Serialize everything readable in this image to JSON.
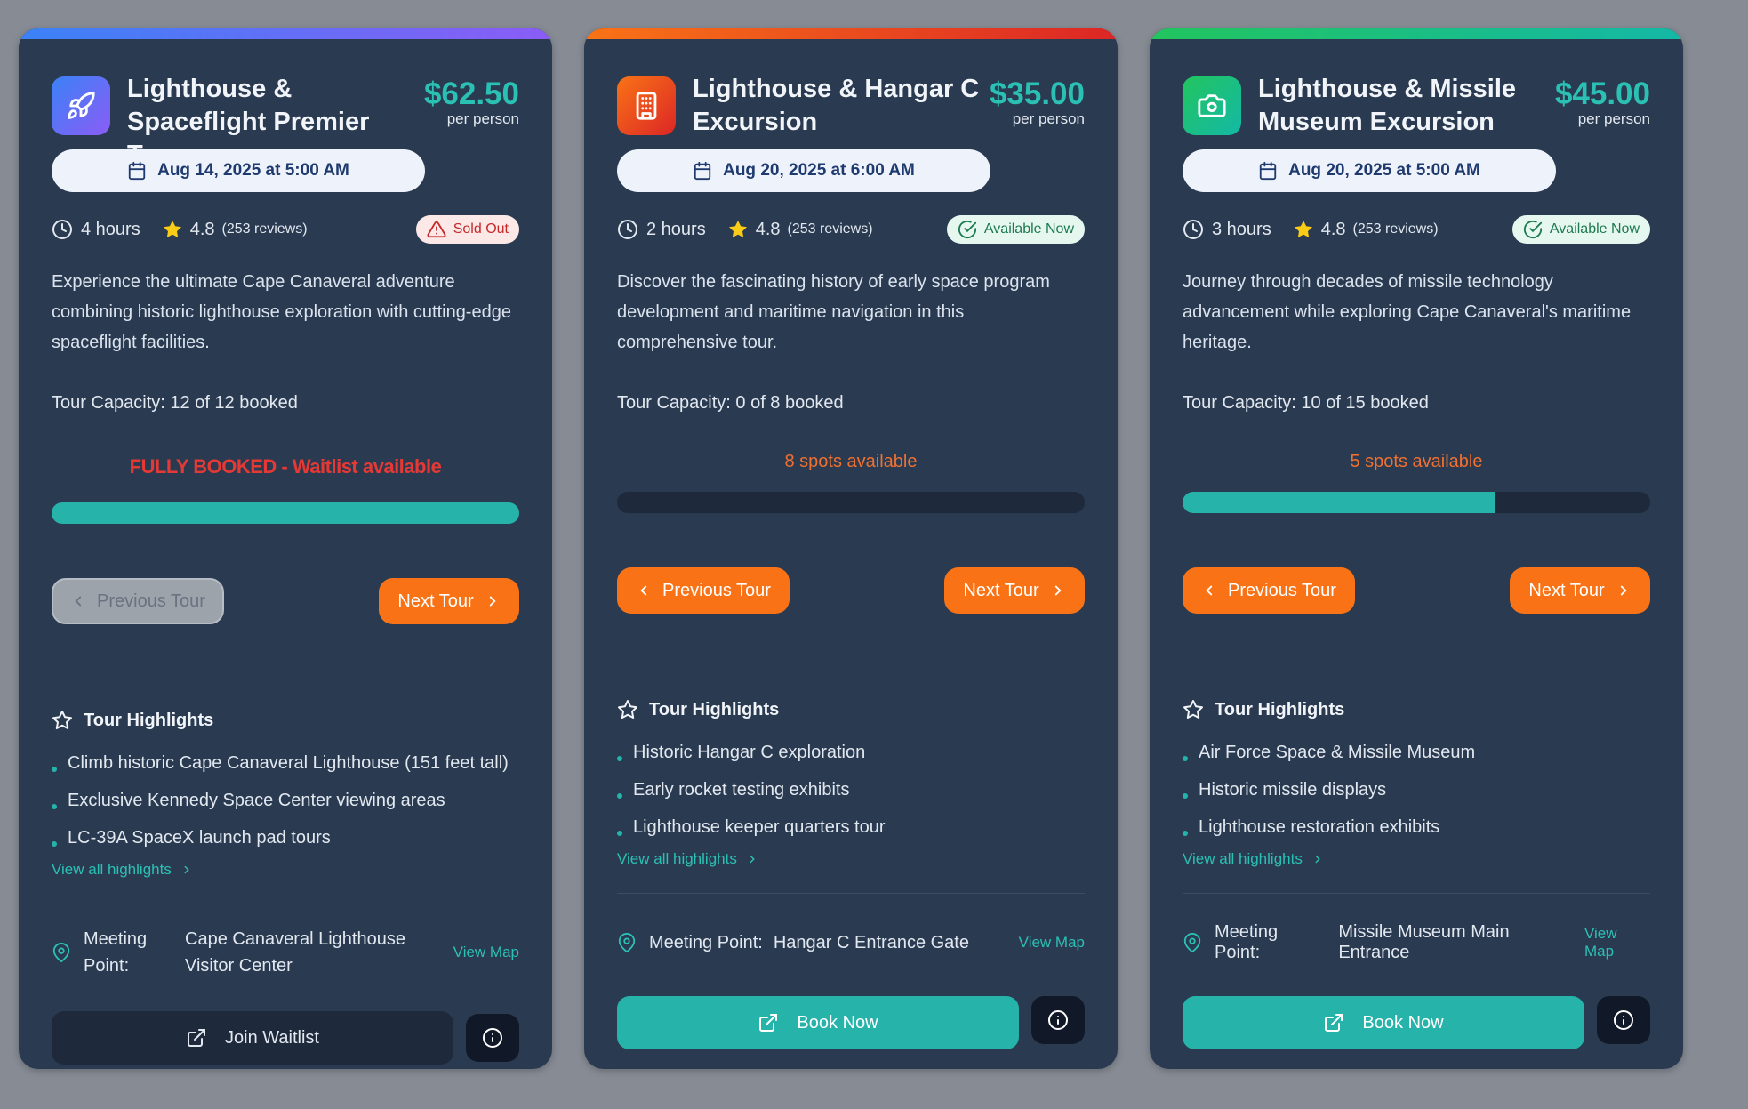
{
  "colors": {
    "teal_accent": "#2bc0b4",
    "orange_accent": "#f97316",
    "card_bg": "#2a3a50",
    "page_bg": "#868b94"
  },
  "cards": [
    {
      "icon": "rocket-icon",
      "icon_gradient": [
        "#3b82f6",
        "#8b5cf6"
      ],
      "top_gradient": [
        "#3b82f6",
        "#8b5cf6"
      ],
      "title": "Lighthouse & Spaceflight Premier Tour",
      "price": "$62.50",
      "per": "per person",
      "date": "Aug 14, 2025 at 5:00 AM",
      "duration": "4 hours",
      "rating": "4.8",
      "reviews": "(253 reviews)",
      "badge": "Sold Out",
      "badge_type": "sold",
      "description": "Experience the ultimate Cape Canaveral adventure combining historic lighthouse exploration with cutting-edge spaceflight facilities.",
      "capacity": "Tour Capacity: 12 of 12 booked",
      "availability": "FULLY BOOKED - Waitlist available",
      "availability_full": true,
      "progress_fraction": 1.0,
      "prev_label": "Previous Tour",
      "prev_disabled": true,
      "next_label": "Next Tour",
      "highlights_title": "Tour Highlights",
      "highlights": [
        "Climb historic Cape Canaveral Lighthouse (151 feet tall)",
        "Exclusive Kennedy Space Center viewing areas",
        "LC-39A SpaceX launch pad tours"
      ],
      "view_all": "View all highlights",
      "meeting_label": "Meeting Point:",
      "meeting_value": "Cape Canaveral Lighthouse Visitor Center",
      "view_map": "View Map",
      "cta_label": "Join Waitlist",
      "cta_type": "waitlist"
    },
    {
      "icon": "building-icon",
      "icon_gradient": [
        "#f97316",
        "#dc2626"
      ],
      "top_gradient": [
        "#f97316",
        "#dc2626"
      ],
      "title": "Lighthouse & Hangar C Excursion",
      "price": "$35.00",
      "per": "per person",
      "date": "Aug 20, 2025 at 6:00 AM",
      "duration": "2 hours",
      "rating": "4.8",
      "reviews": "(253 reviews)",
      "badge": "Available Now",
      "badge_type": "avail",
      "description": "Discover the fascinating history of early space program development and maritime navigation in this comprehensive tour.",
      "capacity": "Tour Capacity: 0 of 8 booked",
      "availability": "8 spots available",
      "availability_full": false,
      "progress_fraction": 0.0,
      "prev_label": "Previous Tour",
      "prev_disabled": false,
      "next_label": "Next Tour",
      "highlights_title": "Tour Highlights",
      "highlights": [
        "Historic Hangar C exploration",
        "Early rocket testing exhibits",
        "Lighthouse keeper quarters tour"
      ],
      "view_all": "View all highlights",
      "meeting_label": "Meeting Point:",
      "meeting_value": "Hangar C Entrance Gate",
      "view_map": "View Map",
      "cta_label": "Book Now",
      "cta_type": "book"
    },
    {
      "icon": "camera-icon",
      "icon_gradient": [
        "#22c55e",
        "#14b8a6"
      ],
      "top_gradient": [
        "#22c55e",
        "#14b8a6"
      ],
      "title": "Lighthouse & Missile Museum Excursion",
      "price": "$45.00",
      "per": "per person",
      "date": "Aug 20, 2025 at 5:00 AM",
      "duration": "3 hours",
      "rating": "4.8",
      "reviews": "(253 reviews)",
      "badge": "Available Now",
      "badge_type": "avail",
      "description": "Journey through decades of missile technology advancement while exploring Cape Canaveral's maritime heritage.",
      "capacity": "Tour Capacity: 10 of 15 booked",
      "availability": "5 spots available",
      "availability_full": false,
      "progress_fraction": 0.667,
      "prev_label": "Previous Tour",
      "prev_disabled": false,
      "next_label": "Next Tour",
      "highlights_title": "Tour Highlights",
      "highlights": [
        "Air Force Space & Missile Museum",
        "Historic missile displays",
        "Lighthouse restoration exhibits"
      ],
      "view_all": "View all highlights",
      "meeting_label": "Meeting Point:",
      "meeting_value": "Missile Museum Main Entrance",
      "view_map": "View Map",
      "cta_label": "Book Now",
      "cta_type": "book"
    }
  ]
}
